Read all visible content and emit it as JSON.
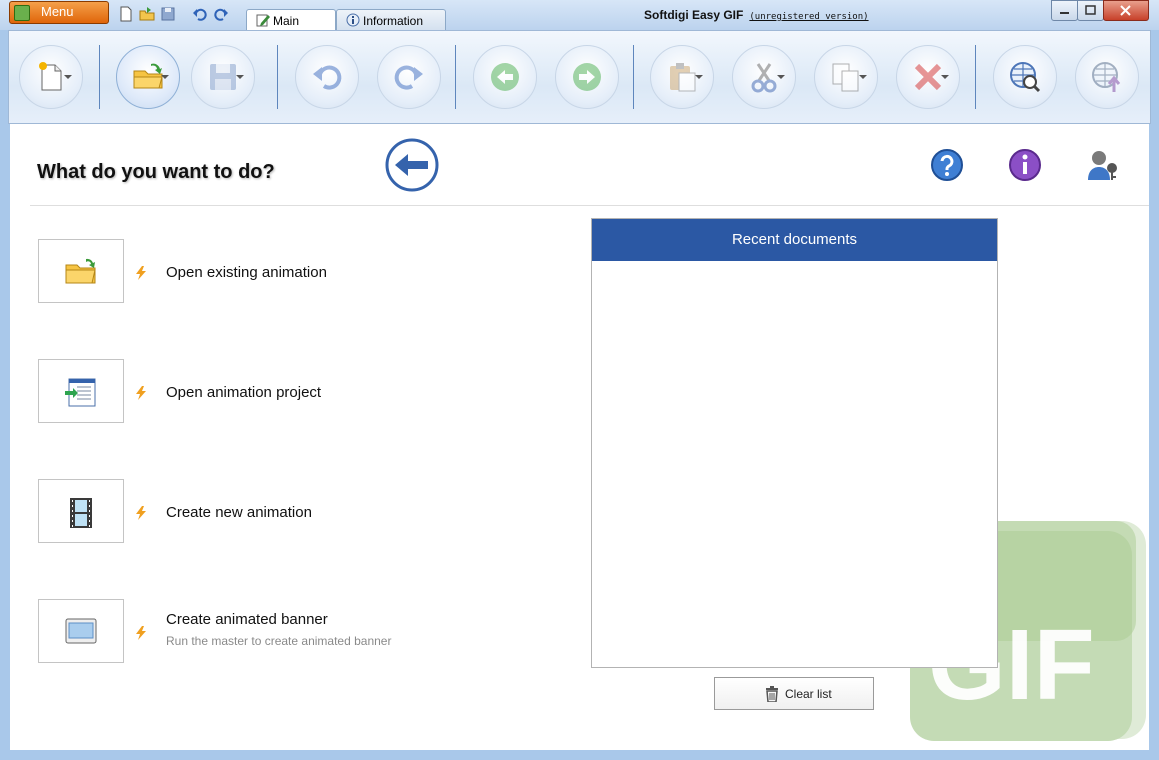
{
  "titlebar": {
    "menu_label": "Menu",
    "tabs": [
      {
        "label": "Main",
        "active": true
      },
      {
        "label": "Information",
        "active": false
      }
    ],
    "app_title": "Softdigi Easy GIF",
    "registration": "(unregistered version)"
  },
  "toolbar": {
    "buttons": [
      {
        "icon": "new-document-icon",
        "dropdown": true
      },
      {
        "icon": "open-folder-icon",
        "dropdown": true
      },
      {
        "icon": "save-icon",
        "dropdown": true
      },
      {
        "icon": "undo-icon",
        "dropdown": false
      },
      {
        "icon": "redo-icon",
        "dropdown": false
      },
      {
        "icon": "previous-frame-icon",
        "dropdown": false
      },
      {
        "icon": "next-frame-icon",
        "dropdown": false
      },
      {
        "icon": "paste-icon",
        "dropdown": true
      },
      {
        "icon": "cut-icon",
        "dropdown": true
      },
      {
        "icon": "copy-icon",
        "dropdown": true
      },
      {
        "icon": "delete-icon",
        "dropdown": true
      },
      {
        "icon": "web-search-icon",
        "dropdown": false
      },
      {
        "icon": "web-upload-icon",
        "dropdown": false
      }
    ]
  },
  "main": {
    "heading": "What do you want to do?",
    "actions": [
      {
        "label": "Open existing animation",
        "subtitle": ""
      },
      {
        "label": "Open animation project",
        "subtitle": ""
      },
      {
        "label": "Create new animation",
        "subtitle": ""
      },
      {
        "label": "Create animated banner",
        "subtitle": "Run the master to create animated banner"
      }
    ],
    "recent_title": "Recent documents",
    "recent_items": [],
    "clear_label": "Clear list",
    "watermark_text": "GIF"
  },
  "colors": {
    "accent_blue": "#2b58a4",
    "menu_orange": "#e0650a",
    "frame_blue": "#a9c8ea"
  }
}
